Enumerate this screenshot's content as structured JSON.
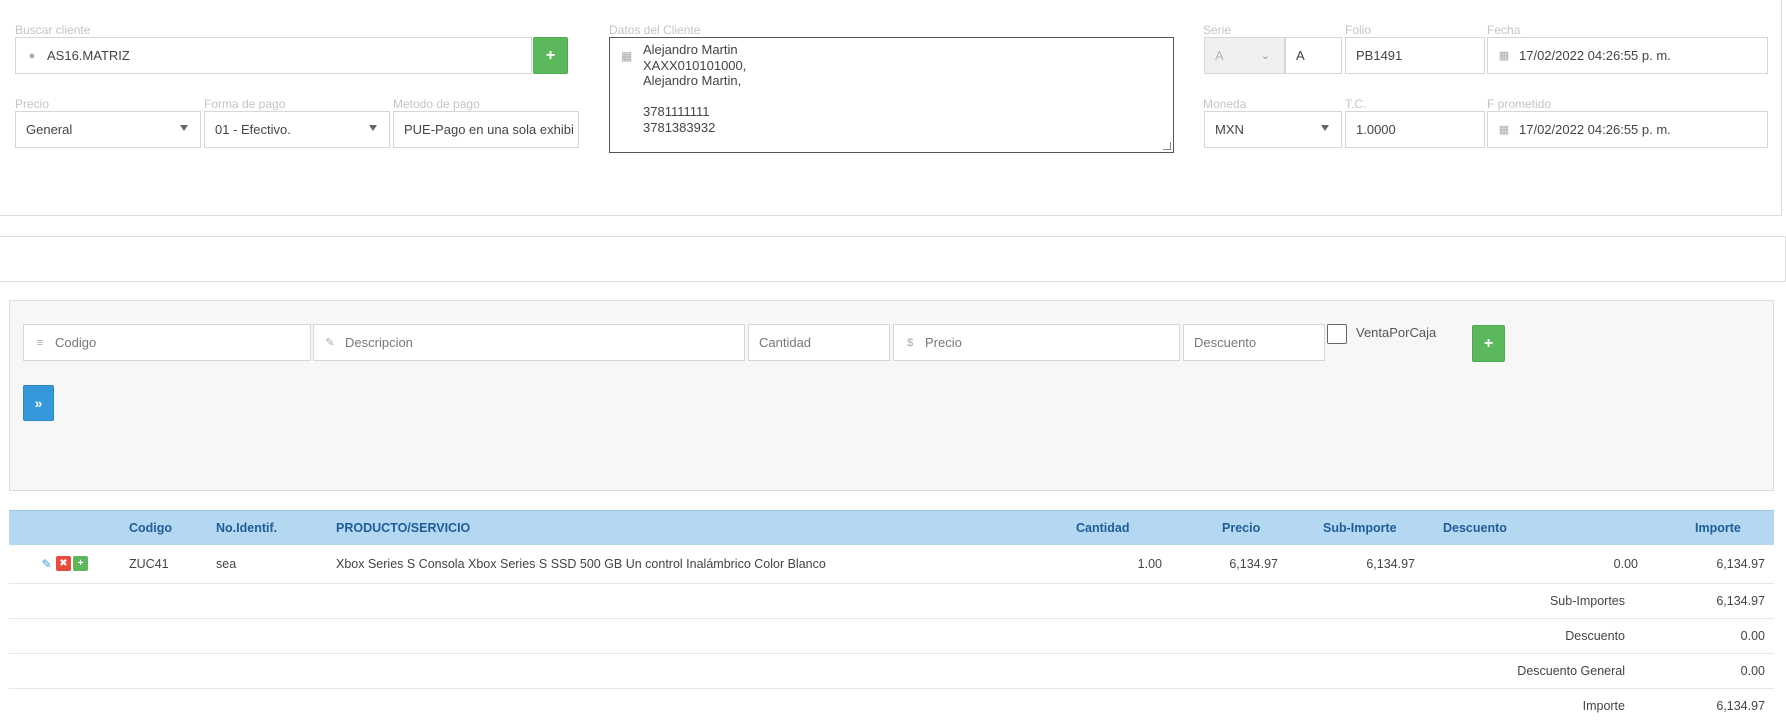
{
  "cliente": {
    "buscar_label": "Buscar cliente",
    "buscar_value": "AS16.MATRIZ",
    "datos_label": "Datos del Cliente",
    "datos_lines": [
      "Alejandro Martin",
      "XAXX010101000,",
      "Alejandro Martin,",
      "",
      "3781111111",
      "3781383932"
    ]
  },
  "precio": {
    "label": "Precio",
    "value": "General"
  },
  "forma_pago": {
    "label": "Forma de pago",
    "value": "01 - Efectivo."
  },
  "metodo_pago": {
    "label": "Metodo de pago",
    "value": "PUE-Pago en una sola exhibi"
  },
  "serie": {
    "label": "Serie",
    "select_value": "A",
    "value": "A"
  },
  "folio": {
    "label": "Folio",
    "value": "PB1491"
  },
  "fecha": {
    "label": "Fecha",
    "value": "17/02/2022 04:26:55 p. m."
  },
  "moneda": {
    "label": "Moneda",
    "value": "MXN"
  },
  "tc": {
    "label": "T.C.",
    "value": "1.0000"
  },
  "f_prometido": {
    "label": "F prometido",
    "value": "17/02/2022 04:26:55 p. m."
  },
  "entry": {
    "codigo_placeholder": "Codigo",
    "descripcion_placeholder": "Descripcion",
    "cantidad_placeholder": "Cantidad",
    "precio_placeholder": "Precio",
    "descuento_placeholder": "Descuento",
    "venta_por_caja_label": "VentaPorCaja"
  },
  "table": {
    "headers": [
      "Codigo",
      "No.Identif.",
      "PRODUCTO/SERVICIO",
      "Cantidad",
      "Precio",
      "Sub-Importe",
      "Descuento",
      "Importe"
    ],
    "rows": [
      {
        "codigo": "ZUC41",
        "no_identif": "sea",
        "producto": "Xbox Series S Consola Xbox Series S SSD 500 GB Un control Inalámbrico Color Blanco",
        "cantidad": "1.00",
        "precio": "6,134.97",
        "sub_importe": "6,134.97",
        "descuento": "0.00",
        "importe": "6,134.97"
      }
    ],
    "totals": [
      {
        "label": "Sub-Importes",
        "value": "6,134.97"
      },
      {
        "label": "Descuento",
        "value": "0.00"
      },
      {
        "label": "Descuento General",
        "value": "0.00"
      },
      {
        "label": "Importe",
        "value": "6,134.97"
      }
    ]
  },
  "icons": {
    "user": "user-icon",
    "building": "building-icon",
    "calendar": "calendar-icon",
    "barcode": "barcode-icon",
    "edit": "edit-icon",
    "dollar": "dollar-icon",
    "plus": "plus-icon",
    "forward": "double-chevron-right-icon"
  },
  "colors": {
    "green": "#5cb85c",
    "blue": "#3498db",
    "red": "#e74c3c",
    "table_header": "#b4d8f1"
  }
}
